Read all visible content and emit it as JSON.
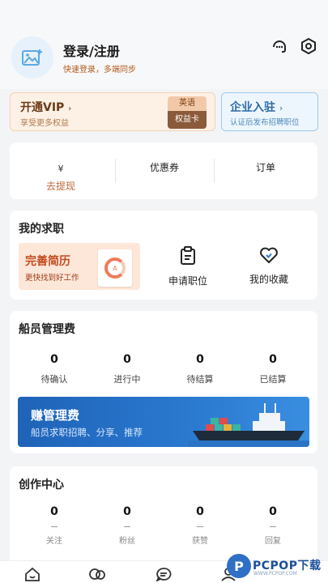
{
  "header": {
    "login_title": "登录/注册",
    "login_subtitle": "快速登录，多端同步",
    "icons": [
      "avatar-placeholder-icon",
      "customer-service-icon",
      "settings-icon"
    ]
  },
  "vip": {
    "title": "开通VIP",
    "subtitle": "享受更多权益",
    "badge_top": "英语",
    "badge_bottom": "权益卡"
  },
  "enterprise": {
    "title": "企业入驻",
    "subtitle": "认证后发布招聘职位"
  },
  "wallet": {
    "currency_symbol": "¥",
    "withdraw": "去提现",
    "coupons": "优惠券",
    "orders": "订单"
  },
  "job_search": {
    "title": "我的求职",
    "resume_title": "完善简历",
    "resume_subtitle": "更快找到好工作",
    "resume_ring": "A",
    "apply": "申请职位",
    "favorites": "我的收藏"
  },
  "crew_fee": {
    "title": "船员管理费",
    "stats": [
      {
        "value": "0",
        "label": "待确认"
      },
      {
        "value": "0",
        "label": "进行中"
      },
      {
        "value": "0",
        "label": "待结算"
      },
      {
        "value": "0",
        "label": "已结算"
      }
    ],
    "banner_title": "赚管理费",
    "banner_subtitle": "船员求职招聘、分享、推荐"
  },
  "creation": {
    "title": "创作中心",
    "stats": [
      {
        "value": "0",
        "label": "关注"
      },
      {
        "value": "0",
        "label": "粉丝"
      },
      {
        "value": "0",
        "label": "获赞"
      },
      {
        "value": "0",
        "label": "回复"
      }
    ]
  },
  "tabbar": {
    "icons": [
      "home-icon",
      "ship-icon",
      "message-icon",
      "profile-icon"
    ]
  },
  "watermark": {
    "logo": "P",
    "text": "PCPOP下载",
    "site": "WWW.PCPOP.COM"
  },
  "colors": {
    "accent_blue": "#2a7ad0",
    "vip_brown": "#6b3a15",
    "resume_orange": "#c44a20"
  }
}
